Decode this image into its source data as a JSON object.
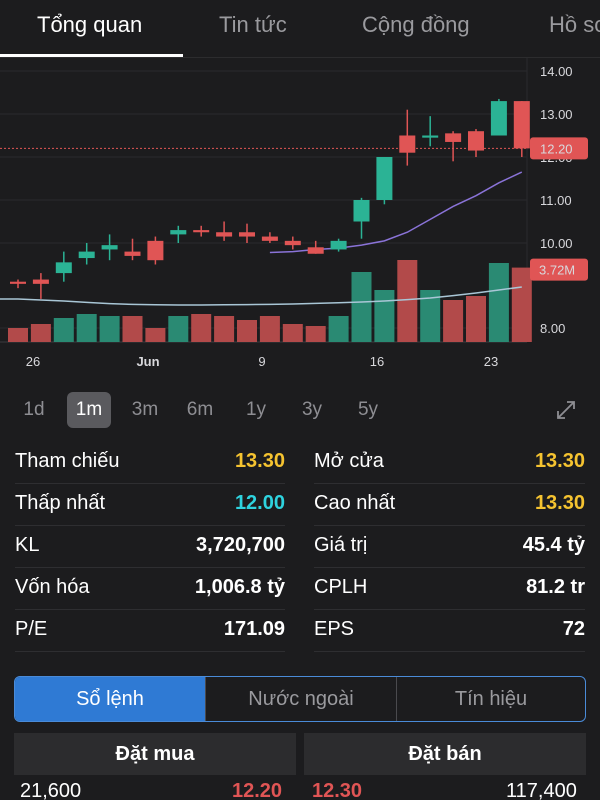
{
  "tabs": [
    {
      "label": "Tổng quan",
      "active": true
    },
    {
      "label": "Tin tức",
      "active": false
    },
    {
      "label": "Cộng đồng",
      "active": false
    },
    {
      "label": "Hồ sơ",
      "active": false
    }
  ],
  "chart_data": {
    "type": "candlestick",
    "y_ticks": [
      "14.00",
      "13.00",
      "12.00",
      "11.00",
      "10.00",
      "8.00"
    ],
    "x_ticks": [
      "26",
      "Jun",
      "9",
      "16",
      "23"
    ],
    "ylim": [
      8.0,
      14.0
    ],
    "last_price": 12.2,
    "last_price_label": "12.20",
    "volume_label": "3.72M",
    "candles": [
      {
        "o": 9.1,
        "h": 9.15,
        "l": 8.95,
        "c": 9.05
      },
      {
        "o": 9.15,
        "h": 9.3,
        "l": 8.7,
        "c": 9.05
      },
      {
        "o": 9.3,
        "h": 9.8,
        "l": 9.1,
        "c": 9.55
      },
      {
        "o": 9.65,
        "h": 10.0,
        "l": 9.5,
        "c": 9.8
      },
      {
        "o": 9.85,
        "h": 10.2,
        "l": 9.6,
        "c": 9.95
      },
      {
        "o": 9.8,
        "h": 10.1,
        "l": 9.6,
        "c": 9.7
      },
      {
        "o": 10.05,
        "h": 10.15,
        "l": 9.5,
        "c": 9.6
      },
      {
        "o": 10.2,
        "h": 10.4,
        "l": 10.0,
        "c": 10.3
      },
      {
        "o": 10.3,
        "h": 10.4,
        "l": 10.15,
        "c": 10.25
      },
      {
        "o": 10.25,
        "h": 10.5,
        "l": 10.05,
        "c": 10.15
      },
      {
        "o": 10.25,
        "h": 10.45,
        "l": 10.0,
        "c": 10.15
      },
      {
        "o": 10.15,
        "h": 10.25,
        "l": 10.0,
        "c": 10.05
      },
      {
        "o": 10.05,
        "h": 10.15,
        "l": 9.85,
        "c": 9.95
      },
      {
        "o": 9.9,
        "h": 10.05,
        "l": 9.75,
        "c": 9.75
      },
      {
        "o": 9.85,
        "h": 10.1,
        "l": 9.8,
        "c": 10.05
      },
      {
        "o": 10.5,
        "h": 11.05,
        "l": 10.1,
        "c": 11.0
      },
      {
        "o": 11.0,
        "h": 12.0,
        "l": 10.9,
        "c": 12.0
      },
      {
        "o": 12.5,
        "h": 13.1,
        "l": 11.8,
        "c": 12.1
      },
      {
        "o": 12.45,
        "h": 12.95,
        "l": 12.25,
        "c": 12.5
      },
      {
        "o": 12.55,
        "h": 12.6,
        "l": 11.9,
        "c": 12.35
      },
      {
        "o": 12.6,
        "h": 12.65,
        "l": 12.0,
        "c": 12.15
      },
      {
        "o": 12.5,
        "h": 13.35,
        "l": 12.5,
        "c": 13.3
      },
      {
        "o": 13.3,
        "h": 13.3,
        "l": 12.0,
        "c": 12.2
      }
    ],
    "volumes": [
      0.7,
      0.9,
      1.2,
      1.4,
      1.3,
      1.3,
      0.7,
      1.3,
      1.4,
      1.3,
      1.1,
      1.3,
      0.9,
      0.8,
      1.3,
      3.5,
      2.6,
      4.1,
      2.6,
      2.1,
      2.3,
      3.95,
      3.72
    ],
    "series": [
      {
        "name": "MA20",
        "values": [
          null,
          null,
          null,
          null,
          null,
          null,
          null,
          null,
          null,
          null,
          null,
          9.78,
          9.8,
          9.85,
          9.88,
          9.95,
          10.05,
          10.25,
          10.55,
          10.85,
          11.1,
          11.4,
          11.65
        ]
      }
    ],
    "volume_ma": [
      2.15,
      2.1,
      2.05,
      1.98,
      1.92,
      1.88,
      1.86,
      1.85,
      1.85,
      1.86,
      1.87,
      1.88,
      1.9,
      1.93,
      1.96,
      2.0,
      2.05,
      2.12,
      2.2,
      2.32,
      2.45,
      2.6,
      2.75
    ],
    "colors": {
      "up": "#2bb395",
      "down": "#e05555",
      "up_vol": "#2a8a73",
      "down_vol": "#b24a4a",
      "ma": "#8a73d8",
      "vol_ma": "#a9c6d6",
      "price_line": "#e05555"
    }
  },
  "ranges": [
    {
      "label": "1d",
      "active": false
    },
    {
      "label": "1m",
      "active": true
    },
    {
      "label": "3m",
      "active": false
    },
    {
      "label": "6m",
      "active": false
    },
    {
      "label": "1y",
      "active": false
    },
    {
      "label": "3y",
      "active": false
    },
    {
      "label": "5y",
      "active": false
    }
  ],
  "stats": {
    "tham_chieu_label": "Tham chiếu",
    "tham_chieu_value": "13.30",
    "mo_cua_label": "Mở cửa",
    "mo_cua_value": "13.30",
    "thap_nhat_label": "Thấp nhất",
    "thap_nhat_value": "12.00",
    "cao_nhat_label": "Cao nhất",
    "cao_nhat_value": "13.30",
    "kl_label": "KL",
    "kl_value": "3,720,700",
    "gia_tri_label": "Giá trị",
    "gia_tri_value": "45.4 tỷ",
    "von_hoa_label": "Vốn hóa",
    "von_hoa_value": "1,006.8 tỷ",
    "cplh_label": "CPLH",
    "cplh_value": "81.2 tr",
    "pe_label": "P/E",
    "pe_value": "171.09",
    "eps_label": "EPS",
    "eps_value": "72"
  },
  "segments": [
    {
      "label": "Sổ lệnh",
      "active": true
    },
    {
      "label": "Nước ngoài",
      "active": false
    },
    {
      "label": "Tín hiệu",
      "active": false
    }
  ],
  "orderbook": {
    "buy_header": "Đặt mua",
    "sell_header": "Đặt bán",
    "row1": {
      "buy_vol": "21,600",
      "buy_price": "12.20",
      "sell_price": "12.30",
      "sell_vol": "117,400"
    }
  }
}
